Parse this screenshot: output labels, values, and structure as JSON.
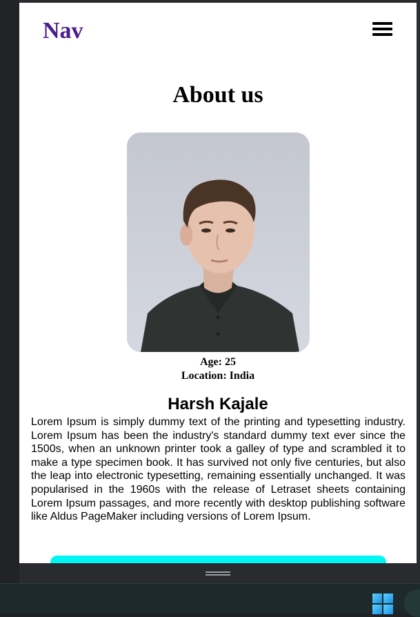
{
  "nav": {
    "logo": "Nav",
    "menu_icon": "hamburger-menu-icon"
  },
  "page": {
    "heading": "About us"
  },
  "profile": {
    "photo_alt": "profile photo",
    "age_line": "Age: 25",
    "location_line": "Location: India",
    "name": "Harsh Kajale",
    "bio": "Lorem Ipsum is simply dummy text of the printing and typesetting industry. Lorem Ipsum has been the industry's standard dummy text ever since the 1500s, when an unknown printer took a galley of type and scrambled it to make a type specimen book. It has survived not only five centuries, but also the leap into electronic typesetting, remaining essentially unchanged. It was popularised in the 1960s with the release of Letraset sheets containing Lorem Ipsum passages, and more recently with desktop publishing software like Aldus PageMaker including versions of Lorem Ipsum."
  },
  "colors": {
    "logo": "#4b1c8a",
    "cta": "#00f5f5",
    "taskbar": "#1c2a2b"
  },
  "taskbar": {
    "start_icon": "windows-start-icon"
  }
}
